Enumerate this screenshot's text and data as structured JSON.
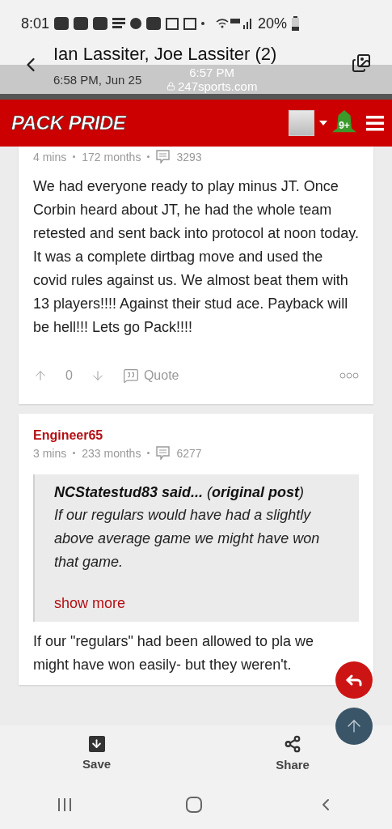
{
  "status_bar": {
    "time": "8:01",
    "battery": "20%"
  },
  "viewer": {
    "title": "Ian Lassiter, Joe Lassiter (2)",
    "subtitle": "6:58 PM, Jun 25"
  },
  "browser": {
    "time": "6:57 PM",
    "url": "247sports.com"
  },
  "site": {
    "logo": "PACK PRIDE",
    "notifications": "9+"
  },
  "posts": [
    {
      "age": "4 mins",
      "tenure": "172 months",
      "post_count": "3293",
      "body": "We had everyone ready to play minus JT. Once Corbin heard about JT, he had the whole team retested and sent back into protocol at noon today. It was a complete dirtbag move and used the covid rules against us. We almost beat them with 13 players!!!! Against their stud ace. Payback will be hell!!! Lets go Pack!!!!",
      "votes": "0",
      "quote_action": "Quote"
    },
    {
      "author": "Engineer65",
      "age": "3 mins",
      "tenure": "233 months",
      "post_count": "6277",
      "quote": {
        "header": "**NCStatestud83 said...** (**original post**)",
        "text": "If our regulars would have had a slightly above average game we might have won that game.",
        "more": "show more"
      },
      "body": "If our \"regulars\" had been allowed to pla we might have won easily- but they weren't."
    }
  ],
  "bottom_actions": [
    {
      "kind": "save",
      "label": "Save"
    },
    {
      "kind": "share",
      "label": "Share"
    }
  ]
}
